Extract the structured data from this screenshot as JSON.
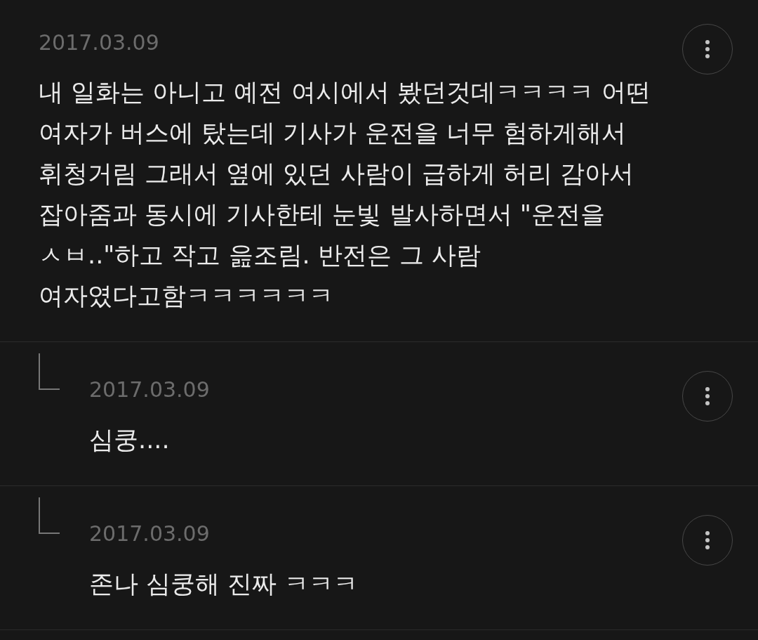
{
  "comments": [
    {
      "kind": "comment",
      "date": "2017.03.09",
      "text": "내 일화는 아니고 예전 여시에서 봤던것데ㅋㅋㅋㅋ 어떤\n여자가 버스에 탔는데 기사가 운전을 너무 험하게해서\n휘청거림 그래서 옆에 있던 사람이 급하게 허리 감아서\n잡아줌과 동시에 기사한테 눈빛 발사하면서 \"운전을\nㅅㅂ..\"하고 작고 읊조림. 반전은 그 사람\n여자였다고함ㅋㅋㅋㅋㅋㅋ"
    },
    {
      "kind": "reply",
      "date": "2017.03.09",
      "text": "심쿵...."
    },
    {
      "kind": "reply",
      "date": "2017.03.09",
      "text": "존나 심쿵해 진짜 ㅋㅋㅋ"
    }
  ]
}
